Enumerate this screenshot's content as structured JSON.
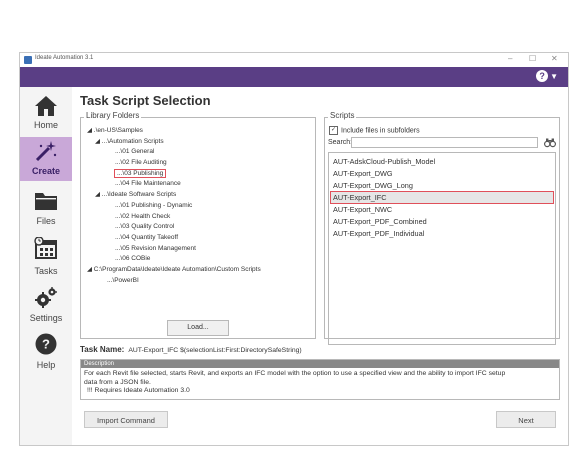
{
  "window": {
    "title": "Ideate Automation 3.1"
  },
  "nav": {
    "items": [
      {
        "label": "Home",
        "icon": "home-icon"
      },
      {
        "label": "Create",
        "icon": "magic-wand-icon",
        "active": true
      },
      {
        "label": "Files",
        "icon": "folder-icon"
      },
      {
        "label": "Tasks",
        "icon": "calendar-clock-icon"
      },
      {
        "label": "Settings",
        "icon": "gears-icon"
      },
      {
        "label": "Help",
        "icon": "question-circle-icon"
      }
    ]
  },
  "main": {
    "heading": "Task Script Selection",
    "library": {
      "title": "Library Folders",
      "tree": [
        "◢ .\\en-US\\Samples",
        "◢ ...\\Automation Scripts",
        "...\\01 General",
        "...\\02 File Auditing",
        "...\\03 Publishing",
        "...\\04 File Maintenance",
        "◢ ...\\Ideate Software Scripts",
        "...\\01 Publishing - Dynamic",
        "...\\02 Health Check",
        "...\\03 Quality Control",
        "...\\04 Quantity Takeoff",
        "...\\05 Revision Management",
        "...\\06 COBie",
        "◢ C:\\ProgramData\\Ideate\\Ideate Automation\\Custom Scripts",
        "...\\PowerBI"
      ],
      "load_label": "Load..."
    },
    "scripts": {
      "title": "Scripts",
      "include_subfolders": "Include files in subfolders",
      "search_label": "Search:",
      "search_value": "",
      "items": [
        "AUT-AdskCloud-Publish_Model",
        "AUT-Export_DWG",
        "AUT-Export_DWG_Long",
        "AUT-Export_IFC",
        "AUT-Export_NWC",
        "AUT-Export_PDF_Combined",
        "AUT-Export_PDF_Individual"
      ],
      "selected": "AUT-Export_IFC"
    },
    "task_name_label": "Task Name:",
    "task_name_value": "AUT-Export_IFC $(selectionList:First:DirectorySafeString)",
    "description": {
      "header": "Description",
      "line1": "For each Revit file selected, starts Revit, and exports an IFC model with the option to use a specified view and the ability to import IFC setup",
      "line2": "data from a JSON file.",
      "line3": "!!! Requires Ideate Automation 3.0"
    },
    "import_label": "Import Command",
    "next_label": "Next"
  },
  "colors": {
    "purple_bar": "#5a3e85",
    "nav_active": "#c9a8d8",
    "highlight": "#e0505a"
  }
}
